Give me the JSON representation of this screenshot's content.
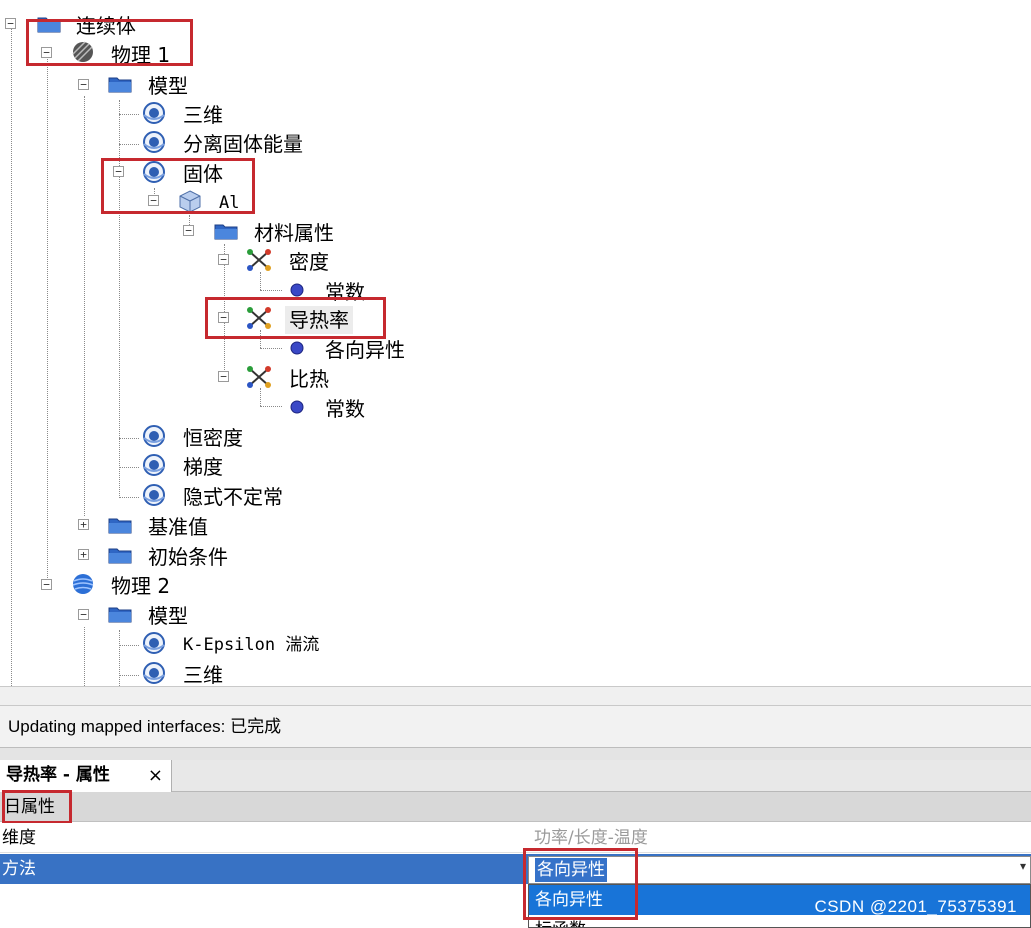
{
  "tree": {
    "root_label": "连续体",
    "physics1_label": "物理 1",
    "model_label": "模型",
    "model_items": [
      "三维",
      "分离固体能量",
      "固体"
    ],
    "material_label": "Al",
    "material_props_label": "材料属性",
    "density_label": "密度",
    "density_method": "常数",
    "conductivity_label": "导热率",
    "conductivity_method": "各向异性",
    "specific_heat_label": "比热",
    "specific_heat_method": "常数",
    "more_models": [
      "恒密度",
      "梯度",
      "隐式不定常"
    ],
    "reference_values_label": "基准值",
    "initial_conditions_label": "初始条件",
    "physics2_label": "物理 2",
    "model2_label": "模型",
    "model2_items": [
      "K-Epsilon 湍流",
      "三维"
    ]
  },
  "status": {
    "text": "Updating mapped interfaces: 已完成"
  },
  "properties": {
    "tab_title": "导热率 - 属性",
    "tab_close": "×",
    "section_label": "属性",
    "section_toggle": "日",
    "rows": [
      {
        "name": "维度",
        "value": "功率/长度-温度"
      },
      {
        "name": "方法",
        "value": "各向异性"
      }
    ],
    "dropdown_arrow": "▾",
    "options": [
      "各向异性",
      "标函数"
    ]
  },
  "watermark": "CSDN @2201_75375391",
  "colors": {
    "highlight_box": "#c6292f",
    "selection_blue": "#3872c4",
    "folder_blue": "#2f66c4"
  }
}
